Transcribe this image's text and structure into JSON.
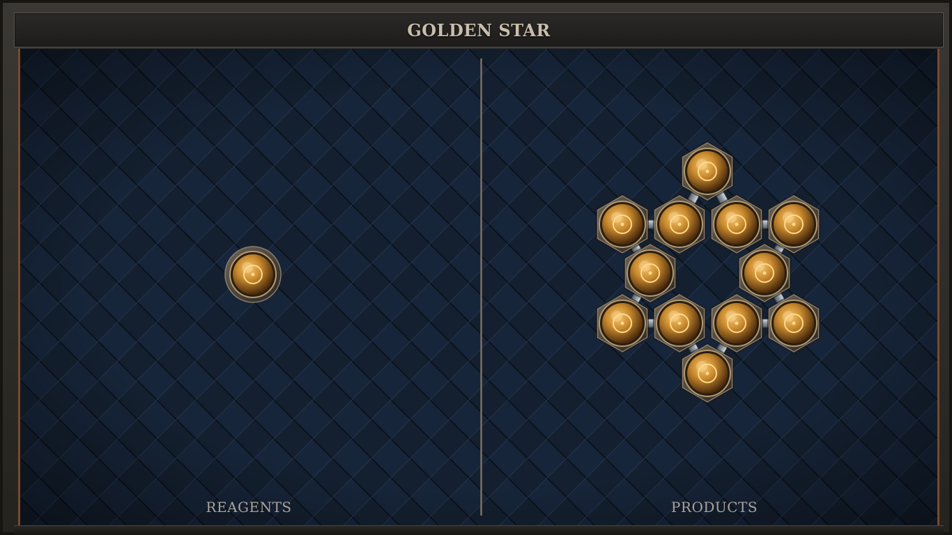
{
  "title": "GOLDEN STAR",
  "panels": {
    "reagents_label": "REAGENTS",
    "products_label": "PRODUCTS"
  },
  "atom_icon": "gold-atom-icon",
  "bond_icon": "silver-bond-icon",
  "colors": {
    "board_background": "#142030",
    "gold_atom": "#c98a2e",
    "bond": "#a8b0b8",
    "title_text": "#c9beab",
    "label_text": "#a9a49b",
    "frame_accent": "#7a4a2a"
  },
  "reagents": {
    "atom_count": 1,
    "bond_count": 0
  },
  "products": {
    "atom_count": 12,
    "bond_count": 12
  }
}
